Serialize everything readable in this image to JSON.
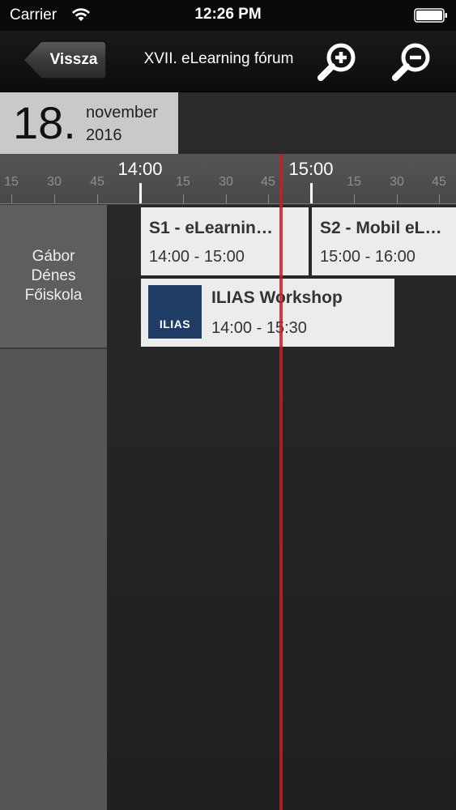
{
  "status_bar": {
    "carrier": "Carrier",
    "time": "12:26 PM"
  },
  "nav": {
    "back_label": "Vissza",
    "title": "XVII. eLearning fórum",
    "zoom_in_icon": "zoom-in-icon",
    "zoom_out_icon": "zoom-out-icon"
  },
  "date": {
    "day": "18.",
    "month": "november",
    "year": "2016"
  },
  "timeline": {
    "ticks": [
      "15",
      "30",
      "45",
      "14:00",
      "15",
      "30",
      "45",
      "15:00",
      "15",
      "30",
      "45"
    ]
  },
  "rooms": [
    {
      "name_lines": [
        "Gábor",
        "Dénes",
        "Főiskola"
      ]
    }
  ],
  "events": [
    {
      "title": "S1 - eLearnin…",
      "time": "14:00 - 15:00"
    },
    {
      "title": "S2 - Mobil eL…",
      "time": "15:00 - 16:00"
    },
    {
      "title": "ILIAS Workshop",
      "time": "14:00 - 15:30",
      "logo_text": "ILIAS"
    }
  ],
  "colors": {
    "now_indicator": "#c81e1e",
    "ilias_logo": "#1e3c66",
    "event_bg": "#ececec"
  }
}
